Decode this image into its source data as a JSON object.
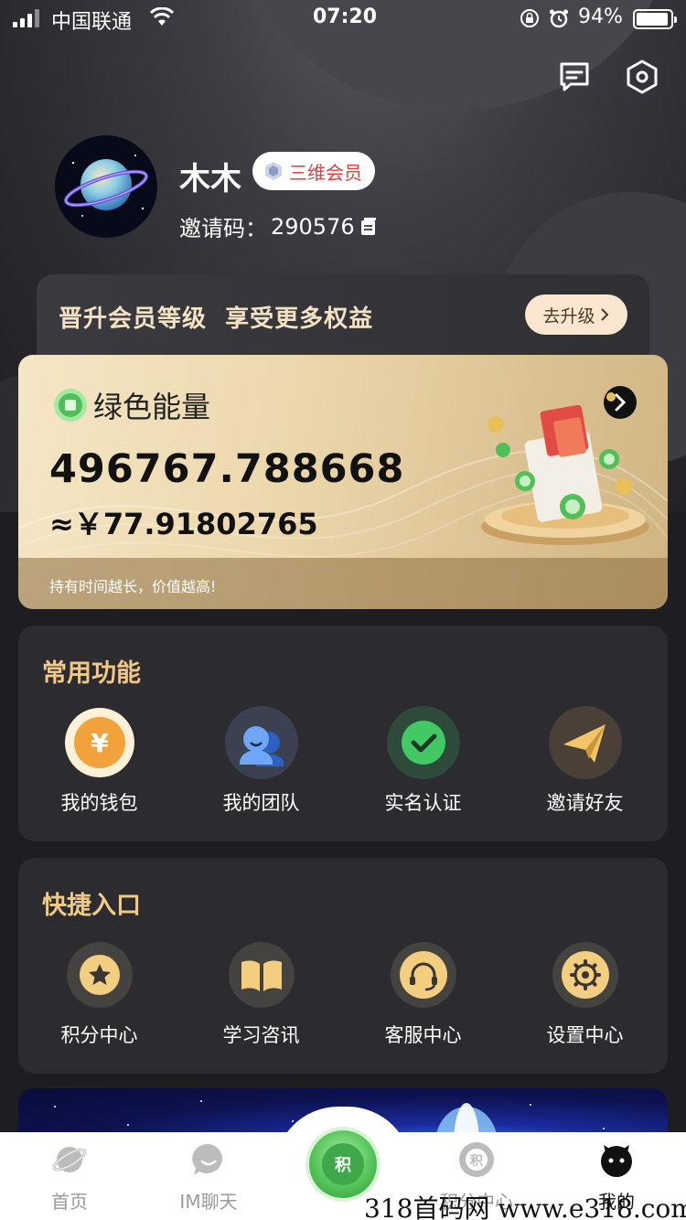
{
  "status_bar": {
    "carrier": "中国联通",
    "time": "07:20",
    "battery": "94%"
  },
  "profile": {
    "username": "木木",
    "member_level": "三维会员",
    "invite_label": "邀请码：",
    "invite_code": "290576"
  },
  "upgrade": {
    "text": "晋升会员等级  享受更多权益",
    "button": "去升级"
  },
  "energy": {
    "title": "绿色能量",
    "amount": "496767.788668",
    "cny": "≈￥77.91802765",
    "footer": "持有时间越长，价值越高!"
  },
  "common_functions": {
    "title": "常用功能",
    "items": [
      {
        "label": "我的钱包",
        "icon": "wallet-yen-icon"
      },
      {
        "label": "我的团队",
        "icon": "team-icon"
      },
      {
        "label": "实名认证",
        "icon": "verified-check-icon"
      },
      {
        "label": "邀请好友",
        "icon": "paper-plane-icon"
      }
    ]
  },
  "quick_entry": {
    "title": "快捷入口",
    "items": [
      {
        "label": "积分中心",
        "icon": "star-icon"
      },
      {
        "label": "学习咨讯",
        "icon": "book-icon"
      },
      {
        "label": "客服中心",
        "icon": "headset-icon"
      },
      {
        "label": "设置中心",
        "icon": "gear-icon"
      }
    ]
  },
  "tab_bar": {
    "items": [
      {
        "label": "首页",
        "icon": "planet-icon"
      },
      {
        "label": "IM聊天",
        "icon": "chat-bubble-icon"
      },
      {
        "label": "",
        "icon": "green-energy-icon"
      },
      {
        "label": "积分中心",
        "icon": "points-icon"
      },
      {
        "label": "我的",
        "icon": "profile-face-icon"
      }
    ],
    "center_glyph": "积"
  },
  "watermark": "318首码网 www.e318.com",
  "colors": {
    "accent_gold": "#f1c987",
    "badge_red": "#e04040",
    "panel_bg": "#2c2c30",
    "green": "#4fbf57"
  }
}
